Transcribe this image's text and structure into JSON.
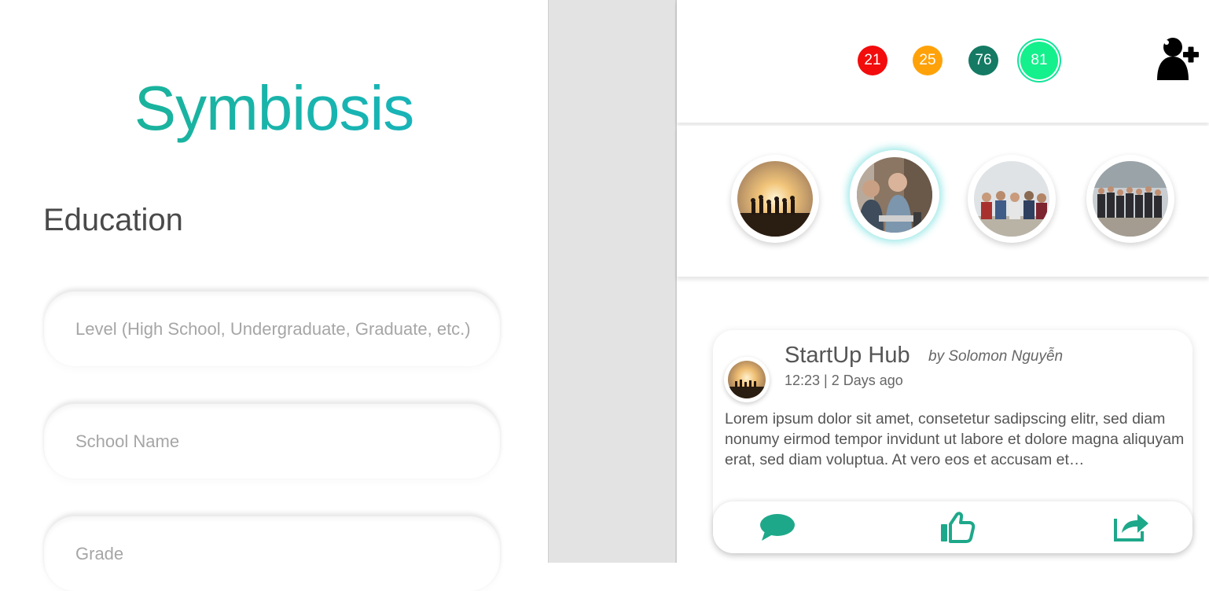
{
  "app": {
    "title": "Symbiosis"
  },
  "form": {
    "heading": "Education",
    "fields": [
      {
        "placeholder": "Level (High School, Undergraduate, Graduate, etc.)",
        "value": ""
      },
      {
        "placeholder": "School Name",
        "value": ""
      },
      {
        "placeholder": "Grade",
        "value": ""
      }
    ]
  },
  "badges": [
    {
      "value": "21",
      "color": "#f20c0c"
    },
    {
      "value": "25",
      "color": "#ffa20a"
    },
    {
      "value": "76",
      "color": "#147a63"
    },
    {
      "value": "81",
      "color": "#14f08c"
    }
  ],
  "icons": {
    "add_user": "add-user-icon",
    "comment": "comment-icon",
    "like": "thumbs-up-icon",
    "share": "share-icon"
  },
  "colors": {
    "accent": "#1ea88a",
    "title_start": "#1bb28e",
    "title_end": "#17b5c6"
  },
  "post": {
    "title": "StartUp Hub",
    "author": "by Solomon Nguyễn",
    "time": "12:23 | 2 Days ago",
    "body": "Lorem ipsum dolor sit amet, consetetur sadipscing elitr, sed diam nonumy eirmod tempor invidunt ut labore et dolore magna aliquyam erat, sed diam voluptua. At vero eos et accusam et…"
  }
}
